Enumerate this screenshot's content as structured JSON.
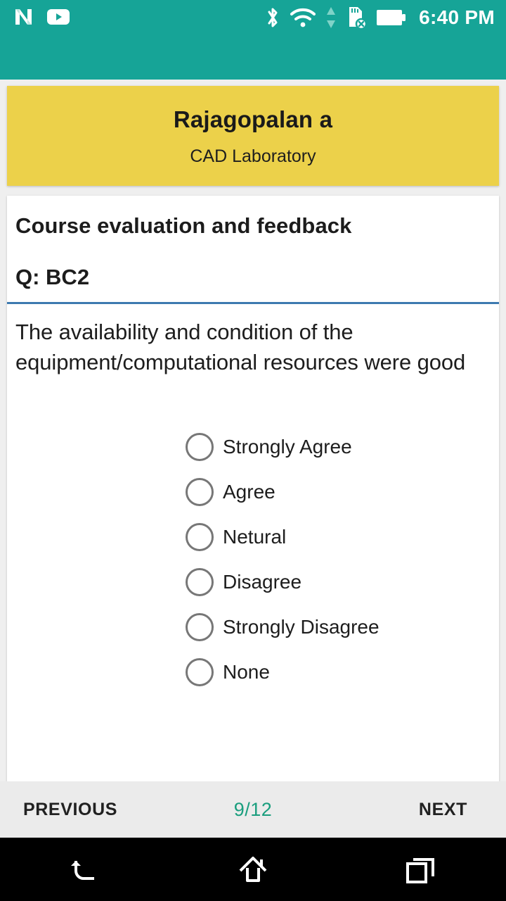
{
  "status_bar": {
    "time": "6:40 PM",
    "background_color": "#16a497",
    "notification_icons": [
      "n-logo-icon",
      "youtube-icon"
    ],
    "system_icons": [
      "bluetooth-icon",
      "wifi-icon",
      "data-transfer-icon",
      "sd-card-error-icon",
      "battery-full-icon"
    ]
  },
  "header": {
    "title": "Rajagopalan a",
    "subtitle": "CAD Laboratory",
    "background_color": "#ecd14a"
  },
  "survey": {
    "title": "Course evaluation and feedback",
    "question_code": "Q: BC2",
    "question_text": "The availability and condition of the equipment/computational resources were good",
    "divider_color": "#3d7ab0",
    "options": [
      {
        "label": "Strongly Agree",
        "selected": false
      },
      {
        "label": "Agree",
        "selected": false
      },
      {
        "label": "Netural",
        "selected": false
      },
      {
        "label": "Disagree",
        "selected": false
      },
      {
        "label": "Strongly Disagree",
        "selected": false
      },
      {
        "label": "None",
        "selected": false
      }
    ]
  },
  "bottom_bar": {
    "previous_label": "PREVIOUS",
    "next_label": "NEXT",
    "page_indicator": "9/12",
    "page_indicator_color": "#1a9e7e"
  },
  "system_nav": {
    "back": "back-icon",
    "home": "home-icon",
    "recents": "recents-icon"
  }
}
